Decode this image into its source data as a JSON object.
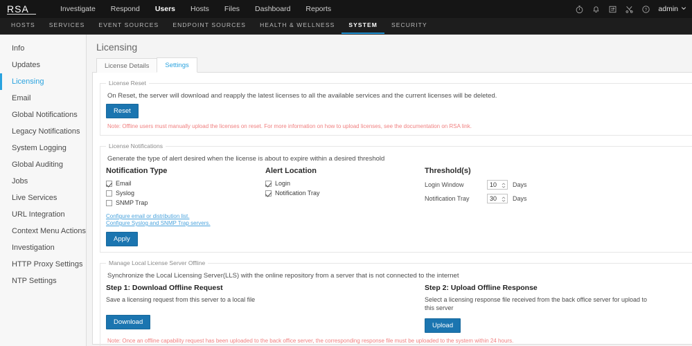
{
  "topnav": {
    "logo": "RSA",
    "items": [
      {
        "label": "Investigate",
        "active": false
      },
      {
        "label": "Respond",
        "active": false
      },
      {
        "label": "Users",
        "active": true
      },
      {
        "label": "Hosts",
        "active": false
      },
      {
        "label": "Files",
        "active": false
      },
      {
        "label": "Dashboard",
        "active": false
      },
      {
        "label": "Reports",
        "active": false
      }
    ],
    "icons": [
      "stopwatch-icon",
      "bell-icon",
      "tasks-icon",
      "tools-icon",
      "help-circle-icon"
    ],
    "user": "admin"
  },
  "subnav": {
    "items": [
      {
        "label": "HOSTS",
        "active": false
      },
      {
        "label": "SERVICES",
        "active": false
      },
      {
        "label": "EVENT SOURCES",
        "active": false
      },
      {
        "label": "ENDPOINT SOURCES",
        "active": false
      },
      {
        "label": "HEALTH & WELLNESS",
        "active": false
      },
      {
        "label": "SYSTEM",
        "active": true
      },
      {
        "label": "SECURITY",
        "active": false
      }
    ]
  },
  "sidebar": {
    "items": [
      {
        "label": "Info",
        "active": false
      },
      {
        "label": "Updates",
        "active": false
      },
      {
        "label": "Licensing",
        "active": true
      },
      {
        "label": "Email",
        "active": false
      },
      {
        "label": "Global Notifications",
        "active": false
      },
      {
        "label": "Legacy Notifications",
        "active": false
      },
      {
        "label": "System Logging",
        "active": false
      },
      {
        "label": "Global Auditing",
        "active": false
      },
      {
        "label": "Jobs",
        "active": false
      },
      {
        "label": "Live Services",
        "active": false
      },
      {
        "label": "URL Integration",
        "active": false
      },
      {
        "label": "Context Menu Actions",
        "active": false
      },
      {
        "label": "Investigation",
        "active": false
      },
      {
        "label": "HTTP Proxy Settings",
        "active": false
      },
      {
        "label": "NTP Settings",
        "active": false
      }
    ]
  },
  "main": {
    "title": "Licensing",
    "tabs": [
      {
        "label": "License Details",
        "active": false
      },
      {
        "label": "Settings",
        "active": true
      }
    ],
    "license_reset": {
      "legend": "License Reset",
      "description": "On Reset, the server will download and reapply the latest licenses to all the available services and the current licenses will be deleted.",
      "button": "Reset",
      "note": "Note: Offline users must manually upload the licenses on reset. For more information on how to upload licenses, see the documentation on RSA link."
    },
    "license_notifications": {
      "legend": "License Notifications",
      "description": "Generate the type of alert desired when the license is about to expire within a desired threshold",
      "notification_type": {
        "heading": "Notification Type",
        "options": [
          {
            "label": "Email",
            "checked": true
          },
          {
            "label": "Syslog",
            "checked": false
          },
          {
            "label": "SNMP Trap",
            "checked": false
          }
        ]
      },
      "alert_location": {
        "heading": "Alert Location",
        "options": [
          {
            "label": "Login",
            "checked": true
          },
          {
            "label": "Notification Tray",
            "checked": true
          }
        ]
      },
      "thresholds": {
        "heading": "Threshold(s)",
        "rows": [
          {
            "label": "Login Window",
            "value": "10",
            "unit": "Days"
          },
          {
            "label": "Notification Tray",
            "value": "30",
            "unit": "Days"
          }
        ]
      },
      "links": [
        "Configure email or distribution list.",
        "Configure Syslog and SNMP Trap servers."
      ],
      "apply_button": "Apply"
    },
    "offline": {
      "legend": "Manage Local License Server Offline",
      "description": "Synchronize the Local Licensing Server(LLS) with the online repository from a server that is not connected to the internet",
      "step1": {
        "heading": "Step 1: Download Offline Request",
        "text": "Save a licensing request from this server to a local file",
        "button": "Download"
      },
      "step2": {
        "heading": "Step 2: Upload Offline Response",
        "text": "Select a licensing response file received from the back office server for upload to this server",
        "button": "Upload"
      },
      "note": "Note: Once an offline capability request has been uploaded to the back office server, the corresponding response file must be uploaded to the system within 24 hours."
    }
  },
  "colors": {
    "accent": "#2aa3df",
    "button": "#1b75b0",
    "note": "#f08080",
    "topbar": "#151515"
  }
}
